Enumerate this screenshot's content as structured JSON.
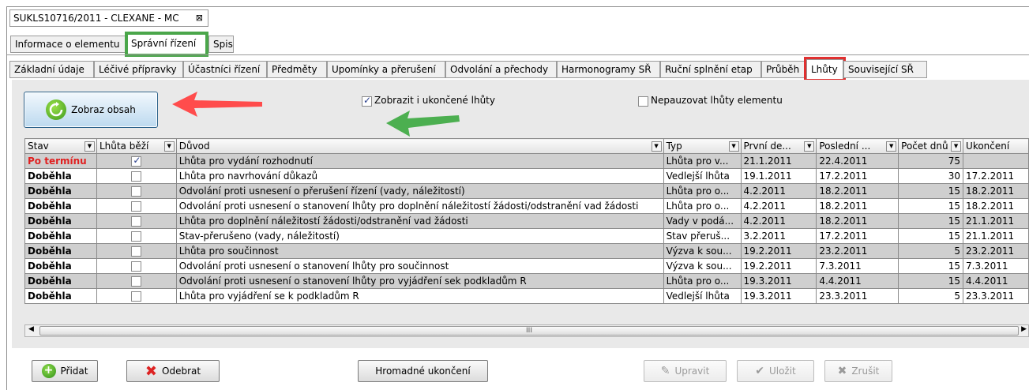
{
  "window": {
    "title": "SUKLS10716/2011 - CLEXANE - MC",
    "close_glyph": "⊠"
  },
  "main_tabs": [
    {
      "label": "Informace o elementu"
    },
    {
      "label": "Správní řízení"
    },
    {
      "label": "Spis"
    }
  ],
  "sub_tabs": [
    {
      "label": "Základní údaje"
    },
    {
      "label": "Léčivé přípravky"
    },
    {
      "label": "Účastníci řízení"
    },
    {
      "label": "Předměty"
    },
    {
      "label": "Upomínky a přerušení"
    },
    {
      "label": "Odvolání a přechody"
    },
    {
      "label": "Harmonogramy SŘ"
    },
    {
      "label": "Ruční splnění etap"
    },
    {
      "label": "Průběh"
    },
    {
      "label": "Lhůty"
    },
    {
      "label": "Související SŘ"
    }
  ],
  "toolbar": {
    "show_button": "Zobraz obsah",
    "show_finished_label": "Zobrazit i ukončené lhůty",
    "show_finished_checked": true,
    "no_pause_label": "Nepauzovat lhůty elementu",
    "no_pause_checked": false
  },
  "table": {
    "columns": [
      "Stav",
      "Lhůta běží",
      "Důvod",
      "Typ",
      "První de...",
      "Poslední ...",
      "Počet dnů",
      "Ukončení"
    ],
    "rows": [
      {
        "stav": "Po termínu",
        "bezi": true,
        "duvod": "Lhůta pro vydání rozhodnutí",
        "typ": "Lhůta pro v...",
        "prvni": "21.1.2011",
        "posledni": "22.4.2011",
        "pocet": "75",
        "ukonceni": ""
      },
      {
        "stav": "Doběhla",
        "bezi": false,
        "duvod": "Lhůta pro navrhování důkazů",
        "typ": "Vedlejší lhůta",
        "prvni": "19.1.2011",
        "posledni": "17.2.2011",
        "pocet": "30",
        "ukonceni": "17.2.2011"
      },
      {
        "stav": "Doběhla",
        "bezi": false,
        "duvod": "Odvolání proti usnesení o přerušení řízení (vady, náležitostí)",
        "typ": "Lhůta pro o...",
        "prvni": "4.2.2011",
        "posledni": "18.2.2011",
        "pocet": "15",
        "ukonceni": "18.2.2011"
      },
      {
        "stav": "Doběhla",
        "bezi": false,
        "duvod": "Odvolání proti usnesení o stanovení lhůty pro doplnění náležitostí žádosti/odstranění vad žádosti",
        "typ": "Lhůta pro o...",
        "prvni": "4.2.2011",
        "posledni": "18.2.2011",
        "pocet": "15",
        "ukonceni": "18.2.2011"
      },
      {
        "stav": "Doběhla",
        "bezi": false,
        "duvod": "Lhůta pro doplnění náležitostí žádosti/odstranění vad žádosti",
        "typ": "Vady v podá...",
        "prvni": "4.2.2011",
        "posledni": "18.2.2011",
        "pocet": "15",
        "ukonceni": "21.1.2011"
      },
      {
        "stav": "Doběhla",
        "bezi": false,
        "duvod": "Stav-přerušeno (vady, náležitostí)",
        "typ": "Stav přeruš...",
        "prvni": "3.2.2011",
        "posledni": "17.2.2011",
        "pocet": "15",
        "ukonceni": "21.1.2011"
      },
      {
        "stav": "Doběhla",
        "bezi": false,
        "duvod": "Lhůta pro součinnost",
        "typ": "Výzva k sou...",
        "prvni": "19.2.2011",
        "posledni": "23.2.2011",
        "pocet": "5",
        "ukonceni": "23.2.2011"
      },
      {
        "stav": "Doběhla",
        "bezi": false,
        "duvod": "Odvolání proti usnesení o stanovení lhůty pro součinnost",
        "typ": "Výzva k sou...",
        "prvni": "19.2.2011",
        "posledni": "7.3.2011",
        "pocet": "15",
        "ukonceni": "7.3.2011"
      },
      {
        "stav": "Doběhla",
        "bezi": false,
        "duvod": "Odvolání proti usnesení o stanovení lhůty pro  vyjádření sek podkladům R",
        "typ": "Lhůta pro o...",
        "prvni": "19.3.2011",
        "posledni": "4.4.2011",
        "pocet": "15",
        "ukonceni": "4.4.2011"
      },
      {
        "stav": "Doběhla",
        "bezi": false,
        "duvod": "Lhůta pro vyjádření se k podkladům R",
        "typ": "Vedlejší lhůta",
        "prvni": "19.3.2011",
        "posledni": "23.3.2011",
        "pocet": "5",
        "ukonceni": "23.3.2011"
      }
    ]
  },
  "scrollbar": {
    "grip": "III"
  },
  "actions": {
    "add": "Přidat",
    "remove": "Odebrat",
    "bulk_end": "Hromadné ukončení",
    "edit": "Upravit",
    "save": "Uložit",
    "cancel": "Zrušit"
  },
  "colors": {
    "red_text": "#e02020",
    "highlight_green": "#4aa64a",
    "highlight_red": "#e03030",
    "arrow_red": "#ff4c4c",
    "arrow_green": "#4caf50"
  }
}
